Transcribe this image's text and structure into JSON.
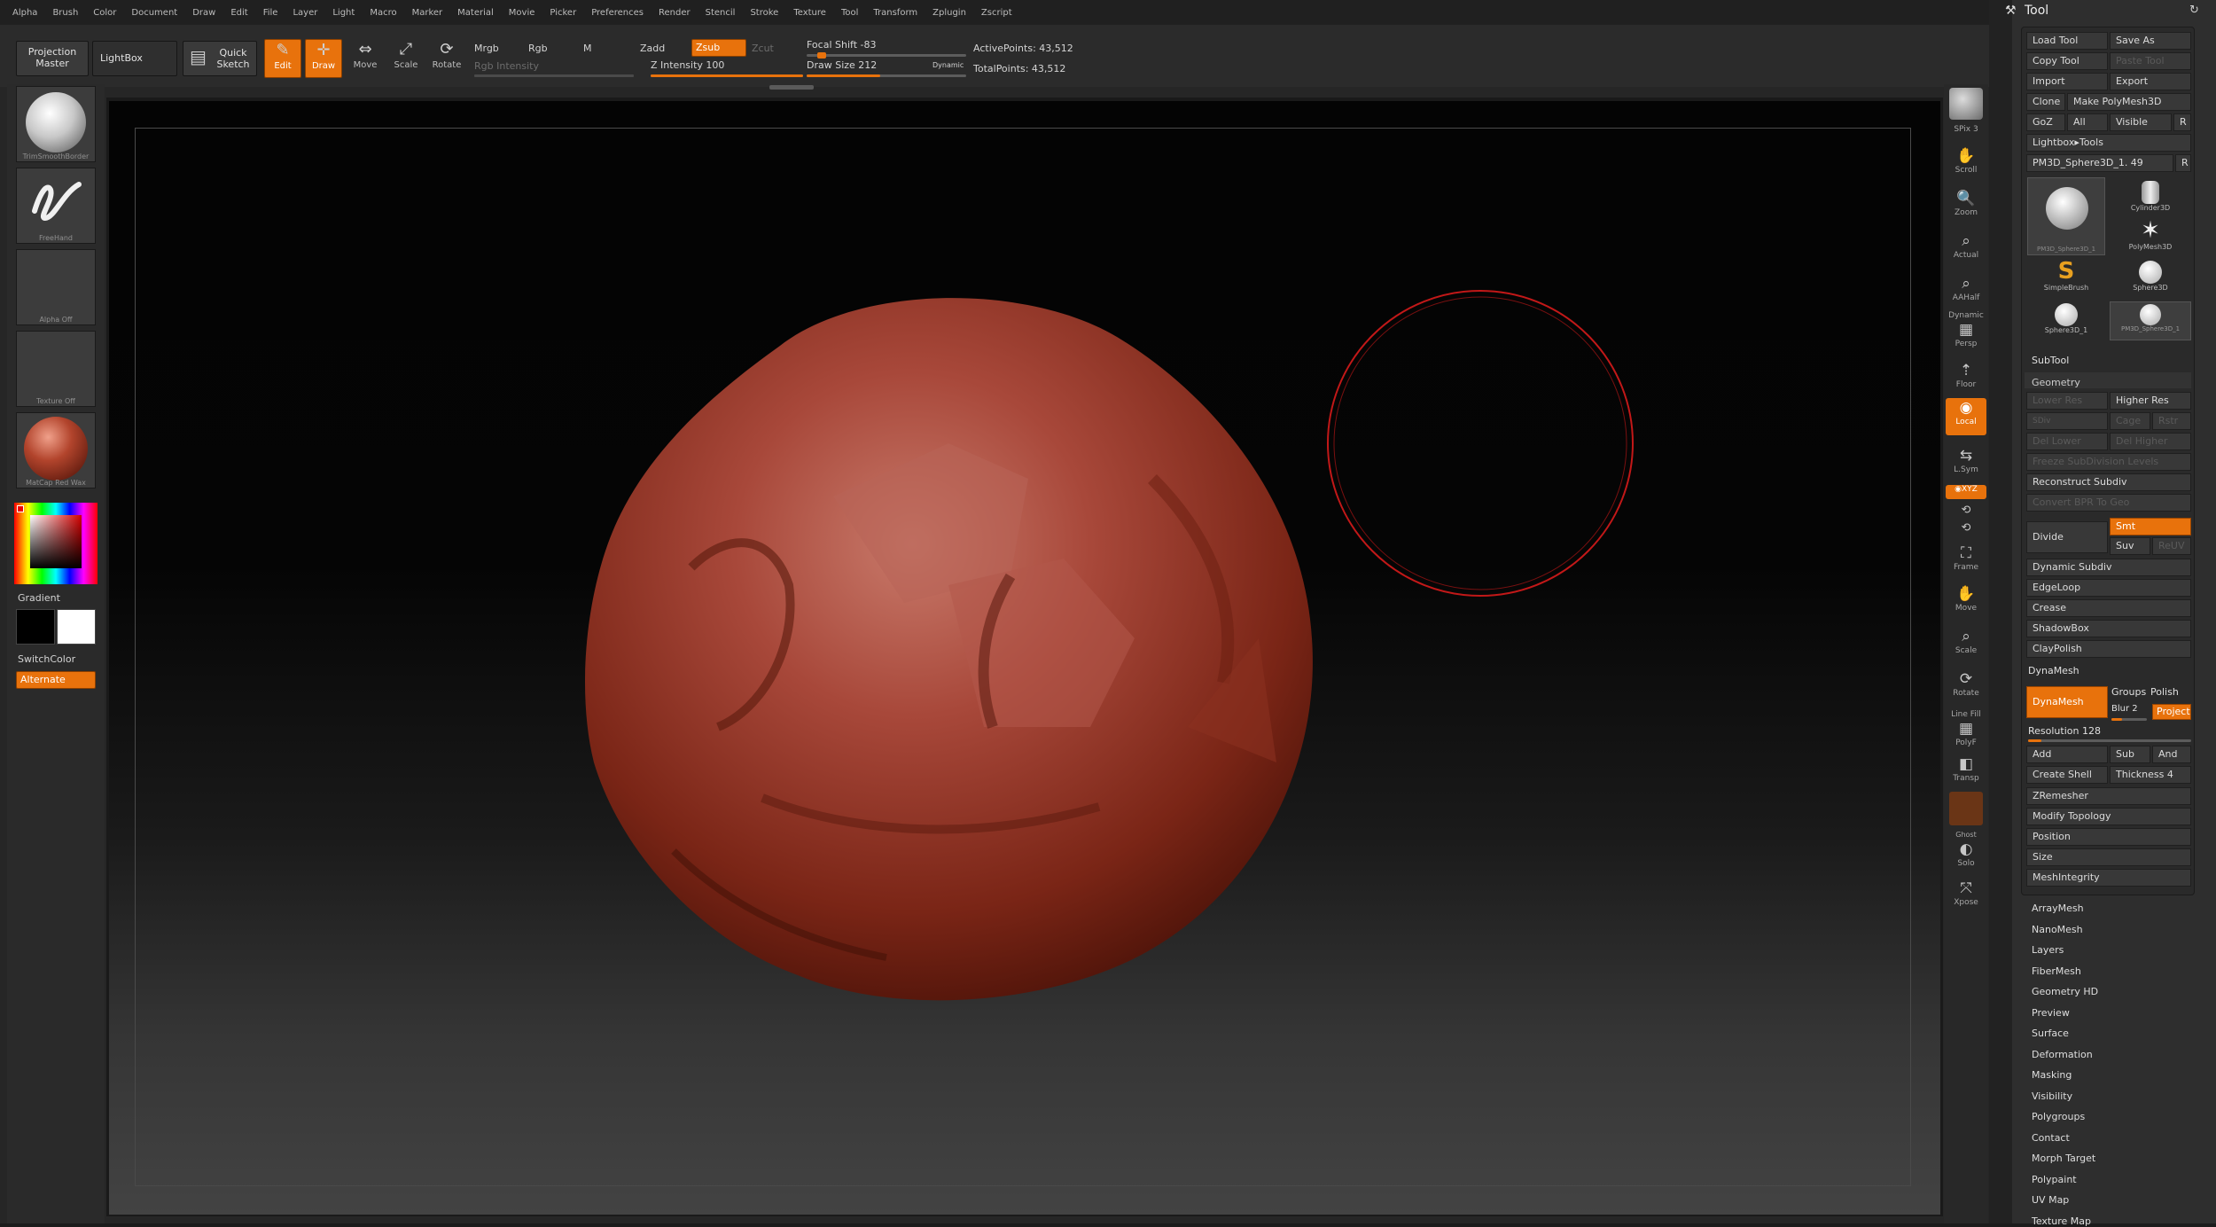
{
  "menubar": [
    "Alpha",
    "Brush",
    "Color",
    "Document",
    "Draw",
    "Edit",
    "File",
    "Layer",
    "Light",
    "Macro",
    "Marker",
    "Material",
    "Movie",
    "Picker",
    "Preferences",
    "Render",
    "Stencil",
    "Stroke",
    "Texture",
    "Tool",
    "Transform",
    "Zplugin",
    "Zscript"
  ],
  "shelf": {
    "projection_master": "Projection Master",
    "lightbox": "LightBox",
    "quick_sketch": "Quick Sketch",
    "edit": "Edit",
    "draw": "Draw",
    "move": "Move",
    "scale": "Scale",
    "rotate": "Rotate",
    "mrgb": "Mrgb",
    "rgb": "Rgb",
    "m": "M",
    "rgb_intensity": "Rgb Intensity",
    "zadd": "Zadd",
    "zsub": "Zsub",
    "zcut": "Zcut",
    "z_intensity": "Z Intensity 100",
    "z_intensity_value": 100,
    "focal_shift": "Focal Shift -83",
    "focal_shift_value": -83,
    "draw_size": "Draw Size 212",
    "draw_size_value": 212,
    "dynamic": "Dynamic",
    "active_points": "ActivePoints: 43,512",
    "total_points": "TotalPoints: 43,512"
  },
  "left": {
    "brush": "TrimSmoothBorder",
    "stroke": "FreeHand",
    "alpha": "Alpha Off",
    "texture": "Texture Off",
    "material": "MatCap Red Wax",
    "gradient": "Gradient",
    "switch_color": "SwitchColor",
    "alternate": "Alternate"
  },
  "right": {
    "spix": "SPix 3",
    "scroll": "Scroll",
    "zoom": "Zoom",
    "actual": "Actual",
    "aahalf": "AAHalf",
    "dynamic": "Dynamic",
    "persp": "Persp",
    "floor": "Floor",
    "local": "Local",
    "lsym": "L.Sym",
    "xyz": "◉XYZ",
    "frame": "Frame",
    "move": "Move",
    "scale": "Scale",
    "rotate": "Rotate",
    "line_fill": "Line Fill",
    "polyf": "PolyF",
    "transp": "Transp",
    "ghost": "Ghost",
    "solo": "Solo",
    "xpose": "Xpose"
  },
  "tool": {
    "title": "Tool",
    "load_tool": "Load Tool",
    "save_as": "Save As",
    "copy_tool": "Copy Tool",
    "paste_tool": "Paste Tool",
    "import": "Import",
    "export": "Export",
    "clone": "Clone",
    "make_polymesh": "Make PolyMesh3D",
    "goz": "GoZ",
    "all": "All",
    "visible": "Visible",
    "r": "R",
    "lightbox_tools": "Lightbox▸Tools",
    "current_tool": "PM3D_Sphere3D_1. 49",
    "thumbs": [
      "PM3D_Sphere3D_1",
      "Cylinder3D",
      "PolyMesh3D",
      "SimpleBrush",
      "Sphere3D",
      "Sphere3D_1",
      "PM3D_Sphere3D_1"
    ],
    "subtool": "SubTool",
    "geometry": "Geometry",
    "lower_res": "Lower Res",
    "higher_res": "Higher Res",
    "sdiv": "SDiv",
    "cage": "Cage",
    "rstr": "Rstr",
    "del_lower": "Del Lower",
    "del_higher": "Del Higher",
    "freeze": "Freeze SubDivision Levels",
    "reconstruct": "Reconstruct Subdiv",
    "convert_bpr": "Convert BPR To Geo",
    "divide": "Divide",
    "smt": "Smt",
    "suv": "Suv",
    "reuv": "ReUV",
    "dynamic_subdiv": "Dynamic Subdiv",
    "edgeloop": "EdgeLoop",
    "crease": "Crease",
    "shadowbox": "ShadowBox",
    "claypolish": "ClayPolish",
    "dynamesh_hdr": "DynaMesh",
    "dynamesh": "DynaMesh",
    "groups": "Groups",
    "polish": "Polish",
    "blur": "Blur 2",
    "project": "Project",
    "resolution": "Resolution 128",
    "add": "Add",
    "sub": "Sub",
    "and": "And",
    "create_shell": "Create Shell",
    "thickness": "Thickness 4",
    "zremesher": "ZRemesher",
    "modify_topology": "Modify Topology",
    "position": "Position",
    "size": "Size",
    "meshintegrity": "MeshIntegrity",
    "sections": [
      "ArrayMesh",
      "NanoMesh",
      "Layers",
      "FiberMesh",
      "Geometry HD",
      "Preview",
      "Surface",
      "Deformation",
      "Masking",
      "Visibility",
      "Polygroups",
      "Contact",
      "Morph Target",
      "Polypaint",
      "UV Map",
      "Texture Map"
    ]
  },
  "colors": {
    "accent": "#e8720c",
    "clay": "#a13a22",
    "brush_ring": "#c21818"
  }
}
